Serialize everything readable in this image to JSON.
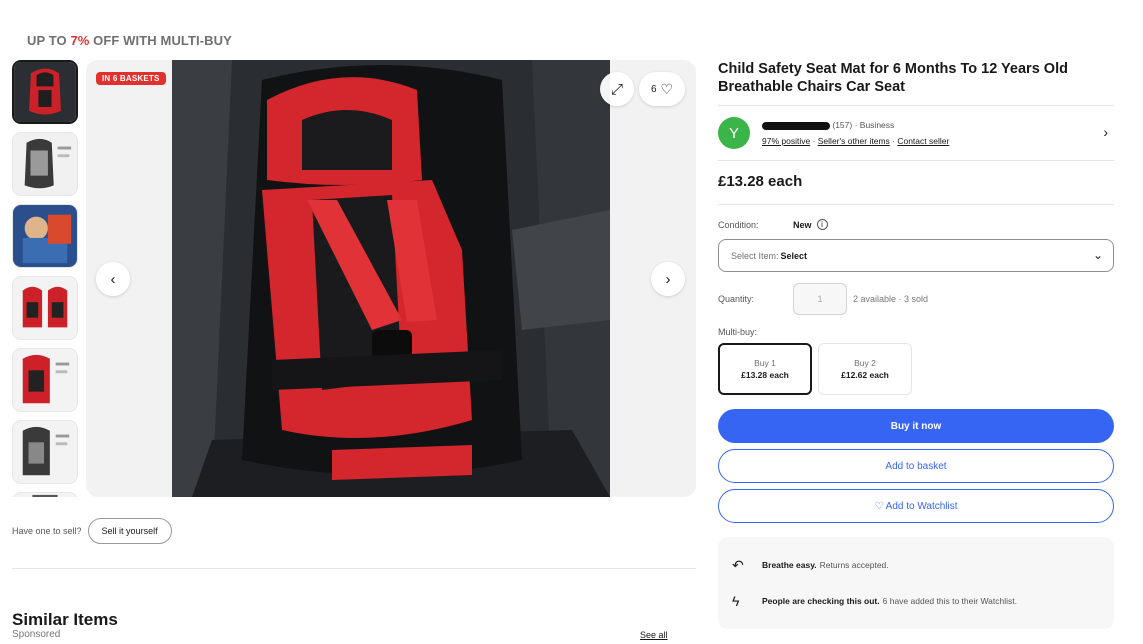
{
  "promo": {
    "prefix": "UP TO ",
    "percent": "7%",
    "suffix": " OFF WITH MULTI-BUY",
    "accent_color": "#e0312e"
  },
  "gallery": {
    "badge": "IN 6 BASKETS",
    "watch_count": "6",
    "thumbnail_count": 7
  },
  "sell": {
    "question": "Have one to sell?",
    "button": "Sell it yourself"
  },
  "similar": {
    "title": "Similar Items",
    "subtitle": "Sponsored",
    "see_all": "See all"
  },
  "product": {
    "title": "Child Safety Seat Mat for 6 Months To 12 Years Old Breathable Chairs Car Seat",
    "price": "£13.28 each"
  },
  "seller": {
    "avatar_letter": "Y",
    "avatar_color": "#3bb54a",
    "feedback_count": "(157)",
    "type": "Business",
    "positive": "97% positive",
    "other_items": "Seller's other items",
    "contact": "Contact seller"
  },
  "condition": {
    "label": "Condition:",
    "value": "New"
  },
  "select": {
    "label": "Select Item:",
    "value": "Select"
  },
  "quantity": {
    "label": "Quantity:",
    "value": "1",
    "note": "2 available · 3 sold"
  },
  "multibuy": {
    "label": "Multi-buy:",
    "tiers": [
      {
        "qty": "Buy 1",
        "price": "£13.28 each"
      },
      {
        "qty": "Buy 2",
        "price": "£12.62 each"
      }
    ]
  },
  "actions": {
    "buy_now": "Buy it now",
    "add_basket": "Add to basket",
    "watchlist": "♡ Add to Watchlist",
    "primary_color": "#3665f3"
  },
  "info": {
    "returns_bold": "Breathe easy.",
    "returns_text": "Returns accepted.",
    "watch_bold": "People are checking this out.",
    "watch_text": "6 have added this to their Watchlist."
  }
}
